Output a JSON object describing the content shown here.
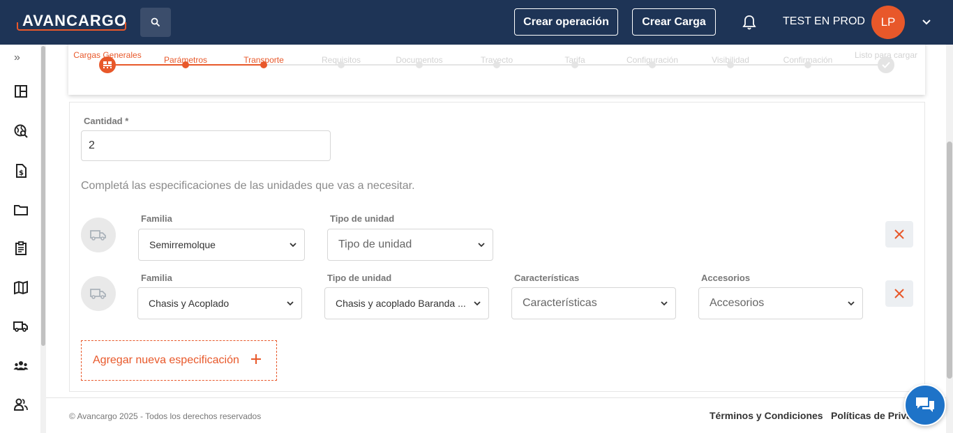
{
  "header": {
    "logo_text": "AVANCARGO",
    "create_operation_label": "Crear operación",
    "create_load_label": "Crear Carga",
    "user_name": "TEST EN PROD",
    "avatar_initials": "LP"
  },
  "sidebar": {
    "expand_label": "»",
    "items": [
      {
        "icon": "dashboard-icon"
      },
      {
        "icon": "globe-search-icon"
      },
      {
        "icon": "invoice-icon"
      },
      {
        "icon": "folder-icon"
      },
      {
        "icon": "clipboard-icon"
      },
      {
        "icon": "map-icon"
      },
      {
        "icon": "truck-icon"
      },
      {
        "icon": "group-icon"
      },
      {
        "icon": "users-icon"
      }
    ]
  },
  "stepper": {
    "steps": [
      {
        "label": "Cargas Generales",
        "state": "current"
      },
      {
        "label": "Parámetros",
        "state": "done"
      },
      {
        "label": "Transporte",
        "state": "done"
      },
      {
        "label": "Requisitos",
        "state": "pending"
      },
      {
        "label": "Documentos",
        "state": "pending"
      },
      {
        "label": "Trayecto",
        "state": "pending"
      },
      {
        "label": "Tarifa",
        "state": "pending"
      },
      {
        "label": "Configuración",
        "state": "pending"
      },
      {
        "label": "Visibilidad",
        "state": "pending"
      },
      {
        "label": "Confirmación",
        "state": "pending"
      },
      {
        "label": "Listo para cargar",
        "state": "final"
      }
    ]
  },
  "form": {
    "quantity_label": "Cantidad *",
    "quantity_value": "2",
    "help_text": "Completá las especificaciones de las unidades que vas a necesitar.",
    "specs": [
      {
        "family_label": "Familia",
        "family_value": "Semirremolque",
        "unit_type_label": "Tipo de unidad",
        "unit_type_value": "Tipo de unidad"
      },
      {
        "family_label": "Familia",
        "family_value": "Chasis y Acoplado",
        "unit_type_label": "Tipo de unidad",
        "unit_type_value": "Chasis y acoplado Baranda ...",
        "features_label": "Características",
        "features_value": "Características",
        "accessories_label": "Accesorios",
        "accessories_value": "Accesorios"
      }
    ],
    "add_spec_label": "Agregar nueva especificación"
  },
  "footer": {
    "copyright": "© Avancargo 2025 - Todos los derechos reservados",
    "terms_label": "Términos y Condiciones",
    "privacy_label": "Políticas de Priva"
  },
  "colors": {
    "navy": "#1e3456",
    "accent": "#e8582a",
    "chat": "#1e73c8"
  }
}
